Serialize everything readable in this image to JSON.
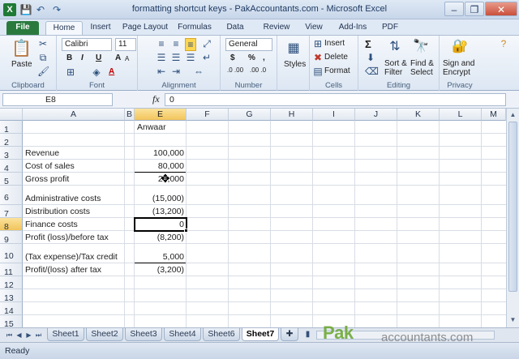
{
  "window": {
    "title": "formatting shortcut keys - PakAccountants.com - Microsoft Excel",
    "minimize": "–",
    "maximize": "❐",
    "close": "✕"
  },
  "qat": {
    "logo": "X",
    "save": "💾",
    "undo": "↶",
    "redo": "↷"
  },
  "tabs": [
    "File",
    "Home",
    "Insert",
    "Page Layout",
    "Formulas",
    "Data",
    "Review",
    "View",
    "Add-Ins",
    "PDF"
  ],
  "ribbon": {
    "clipboard": {
      "label": "Clipboard",
      "paste": "Paste"
    },
    "font": {
      "label": "Font",
      "name": "Calibri",
      "size": "11",
      "bold": "B",
      "italic": "I",
      "underline": "U",
      "grow": "A",
      "shrink": "A",
      "color": "A"
    },
    "alignment": {
      "label": "Alignment"
    },
    "number": {
      "label": "Number",
      "format": "General",
      "currency": "$",
      "percent": "%",
      "comma": ",",
      "inc_dec": ".0 .00",
      "dec_dec": ".00 .0"
    },
    "styles": {
      "label": "Styles"
    },
    "cells": {
      "label": "Cells",
      "insert": "Insert",
      "delete": "Delete",
      "format": "Format"
    },
    "editing": {
      "label": "Editing",
      "sum": "Σ",
      "sort": "Sort &",
      "sort2": "Filter",
      "find": "Find &",
      "find2": "Select"
    },
    "privacy": {
      "label": "Privacy",
      "sign": "Sign and",
      "sign2": "Encrypt"
    }
  },
  "formula_bar": {
    "name_box": "E8",
    "fx": "fx",
    "value": "0"
  },
  "columns": [
    "A",
    "B",
    "E",
    "F",
    "G",
    "H",
    "I",
    "J",
    "K",
    "L",
    "M"
  ],
  "rows": [
    "1",
    "2",
    "3",
    "4",
    "5",
    "6",
    "7",
    "8",
    "9",
    "10",
    "11",
    "12",
    "13",
    "14",
    "15"
  ],
  "selected_cell": {
    "column": "E",
    "row": "8"
  },
  "cells": {
    "E1": "Anwaar",
    "A3": "Revenue",
    "E3": "100,000",
    "A4": "Cost of sales",
    "E4": "80,000",
    "A5": "Gross profit",
    "E5": "20,000",
    "A6": "Administrative costs",
    "E6": "(15,000)",
    "A7": "Distribution costs",
    "E7": "(13,200)",
    "A8": "Finance costs",
    "E8": "0",
    "A9": "Profit (loss)/before tax",
    "E9": "(8,200)",
    "A10": "(Tax expense)/Tax credit",
    "E10": "5,000",
    "A11": "Profit/(loss) after tax",
    "E11": "(3,200)"
  },
  "sheet_nav": [
    "⏮",
    "◀",
    "▶",
    "⏭"
  ],
  "sheets": [
    "Sheet1",
    "Sheet2",
    "Sheet3",
    "Sheet4",
    "Sheet6",
    "Sheet7"
  ],
  "active_sheet": "Sheet7",
  "status": "Ready",
  "watermark": {
    "brand": "Pak",
    "site": "accountants.com"
  }
}
